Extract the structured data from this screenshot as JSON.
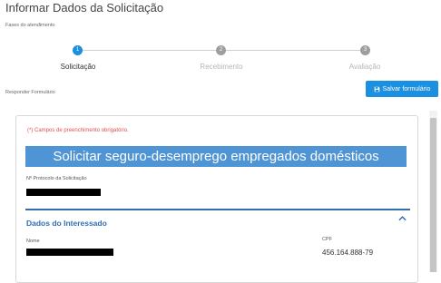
{
  "page": {
    "title": "Informar Dados da Solicitação"
  },
  "phases": {
    "label": "Fases do atendimento",
    "steps": [
      {
        "number": "1",
        "label": "Solicitação",
        "active": true
      },
      {
        "number": "2",
        "label": "Recebimento",
        "active": false
      },
      {
        "number": "3",
        "label": "Avaliação",
        "active": false
      }
    ]
  },
  "form": {
    "section_label": "Responder Formulário",
    "save_label": "Salvar formulário",
    "required_note": "(*) Campos de preenchimento obrigatório.",
    "banner": "Solicitar seguro-desemprego empregados domésticos",
    "protocol_label": "Nº Protocolo da Solicitação",
    "interessado": {
      "title": "Dados do Interessado",
      "nome_label": "Nome",
      "cpf_label": "CPF",
      "cpf_value": "456.164.888-79"
    }
  },
  "colors": {
    "accent": "#1b8fe0",
    "banner": "#4f94d4",
    "section": "#2f6db5",
    "step_inactive": "#9e9e9e",
    "required": "#e05050"
  }
}
